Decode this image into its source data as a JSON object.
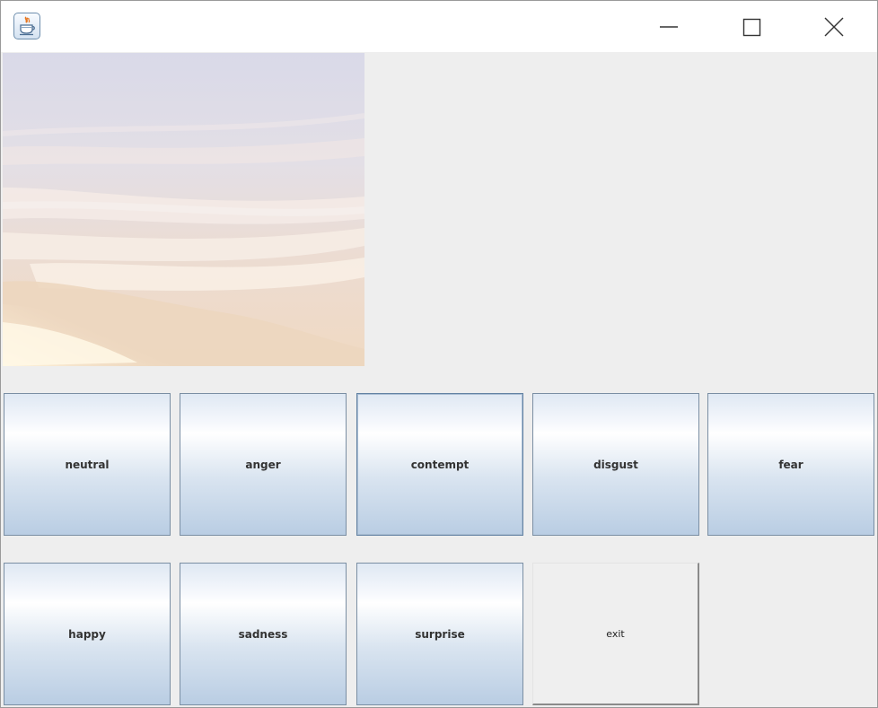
{
  "window": {
    "app_icon": "java-coffee-cup-icon",
    "controls": {
      "minimize_icon": "minimize-icon",
      "maximize_icon": "maximize-icon",
      "close_icon": "close-icon"
    }
  },
  "photo": {
    "description_icon": "sky-clouds-photo"
  },
  "emotion_buttons": {
    "neutral": "neutral",
    "anger": "anger",
    "contempt": "contempt",
    "disgust": "disgust",
    "fear": "fear",
    "happy": "happy",
    "sadness": "sadness",
    "surprise": "surprise"
  },
  "exit_button": {
    "label": "exit"
  },
  "colors": {
    "window_bg": "#eeeeee",
    "titlebar_bg": "#ffffff",
    "button_border": "#7a8ea3",
    "button_gradient_bottom": "#b9cde3"
  }
}
